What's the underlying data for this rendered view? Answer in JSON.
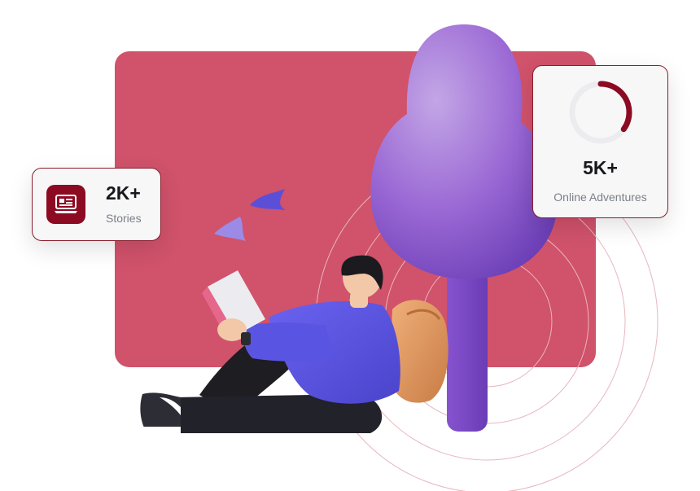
{
  "stories_card": {
    "value": "2K+",
    "label": "Stories",
    "icon": "news-laptop-icon"
  },
  "adventures_card": {
    "value": "5K+",
    "label": "Online Adventures",
    "progress": 0.35
  },
  "colors": {
    "backdrop": "#d0526b",
    "accent": "#8c0a22",
    "tree": "#8d58c9",
    "jacket": "#5b55e0",
    "backpack": "#e39a5e"
  }
}
